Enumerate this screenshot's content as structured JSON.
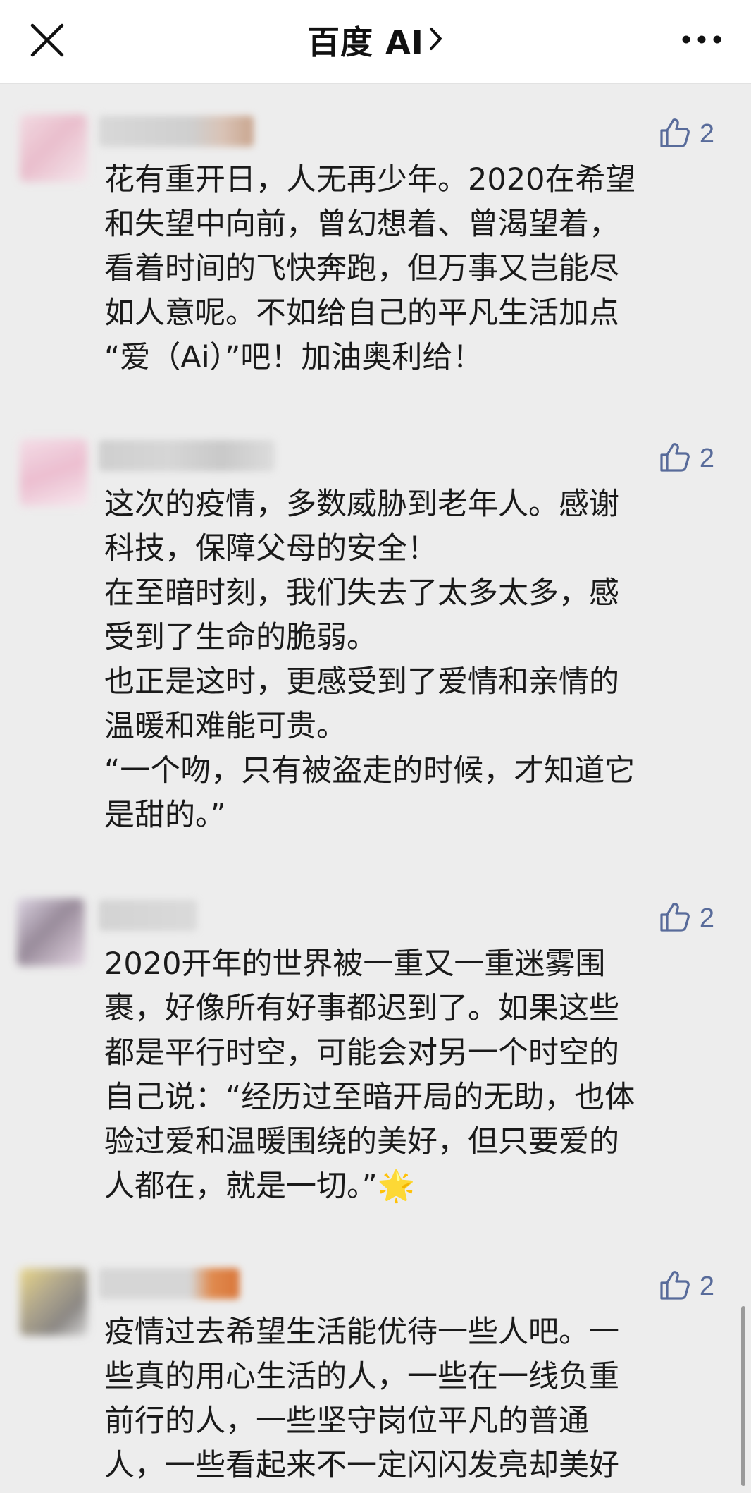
{
  "header": {
    "title": "百度 AI",
    "title_chevron": "chevron-right-icon",
    "close_icon": "close-icon",
    "more_icon": "more-horizontal-icon"
  },
  "comments": [
    {
      "likes": "2",
      "text": "花有重开日，人无再少年。2020在希望\n和失望中向前，曾幻想着、曾渴望着，\n看着时间的飞快奔跑，但万事又岂能尽\n如人意呢。不如给自己的平凡生活加点\n“爱（Ai）”吧！加油奥利给！"
    },
    {
      "likes": "2",
      "text": "这次的疫情，多数威胁到老年人。感谢\n科技，保障父母的安全！\n在至暗时刻，我们失去了太多太多，感\n受到了生命的脆弱。\n也正是这时，更感受到了爱情和亲情的\n温暖和难能可贵。\n“一个吻，只有被盗走的时候，才知道它\n是甜的。”"
    },
    {
      "likes": "2",
      "text": "2020开年的世界被一重又一重迷雾围\n裹，好像所有好事都迟到了。如果这些\n都是平行时空，可能会对另一个时空的\n自己说：“经历过至暗开局的无助，也体\n验过爱和温暖围绕的美好，但只要爱的\n人都在，就是一切。”🌟"
    },
    {
      "likes": "2",
      "text": "疫情过去希望生活能优待一些人吧。一\n些真的用心生活的人，一些在一线负重\n前行的人，一些坚守岗位平凡的普通\n人，一些看起来不一定闪闪发亮却美好"
    }
  ],
  "colors": {
    "like_icon": "#586b9a",
    "background": "#ededed",
    "header_bg": "#ffffff"
  },
  "icons": {
    "like": "thumbs-up-icon"
  }
}
